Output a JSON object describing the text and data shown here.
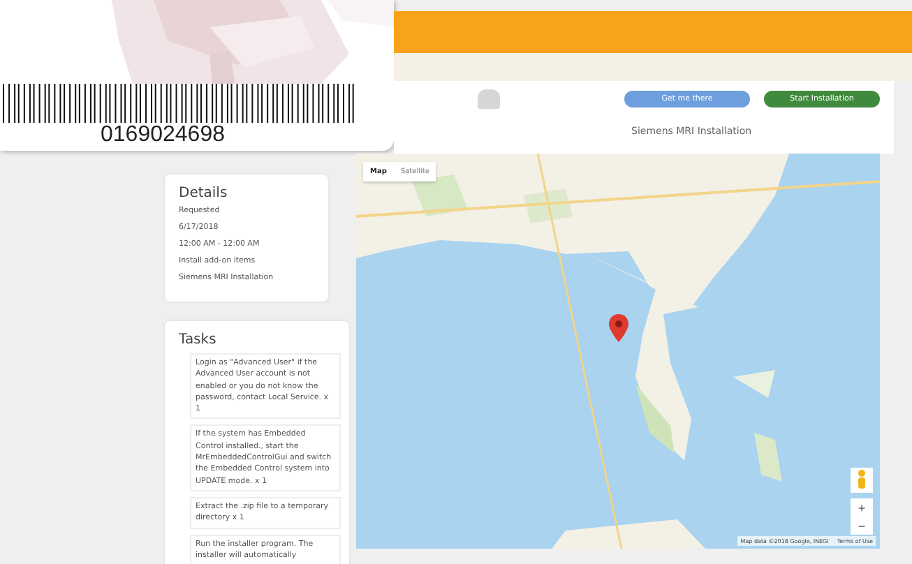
{
  "badge": {
    "barcode_number": "0169024698"
  },
  "actions": {
    "buttons": [
      {
        "label": "Get me there",
        "kind": "secondary"
      },
      {
        "label": "Start Installation",
        "kind": "primary"
      }
    ],
    "title": "Siemens MRI Installation"
  },
  "details": {
    "heading": "Details",
    "lines": [
      "Requested",
      "6/17/2018",
      "12:00 AM - 12:00 AM",
      "Install add-on items",
      "Siemens MRI Installation"
    ]
  },
  "tasks": {
    "heading": "Tasks",
    "items": [
      "Login as \"Advanced User\" if the Advanced User account is not enabled or you do not know the password, contact Local Service. x 1",
      "If the system has Embedded Control installed., start the MrEmbeddedControlGui and switch the Embedded Control system into UPDATE mode. x 1",
      "Extract the .zip file to a temporary directory x 1",
      "Run the installer program.  The installer will automatically"
    ]
  },
  "map": {
    "map_types": [
      {
        "label": "Map",
        "selected": true
      },
      {
        "label": "Satellite",
        "selected": false
      }
    ],
    "zoom_in": "+",
    "zoom_out": "−",
    "attribution": "Map data ©2018 Google, INEGI",
    "terms": "Terms of Use"
  }
}
